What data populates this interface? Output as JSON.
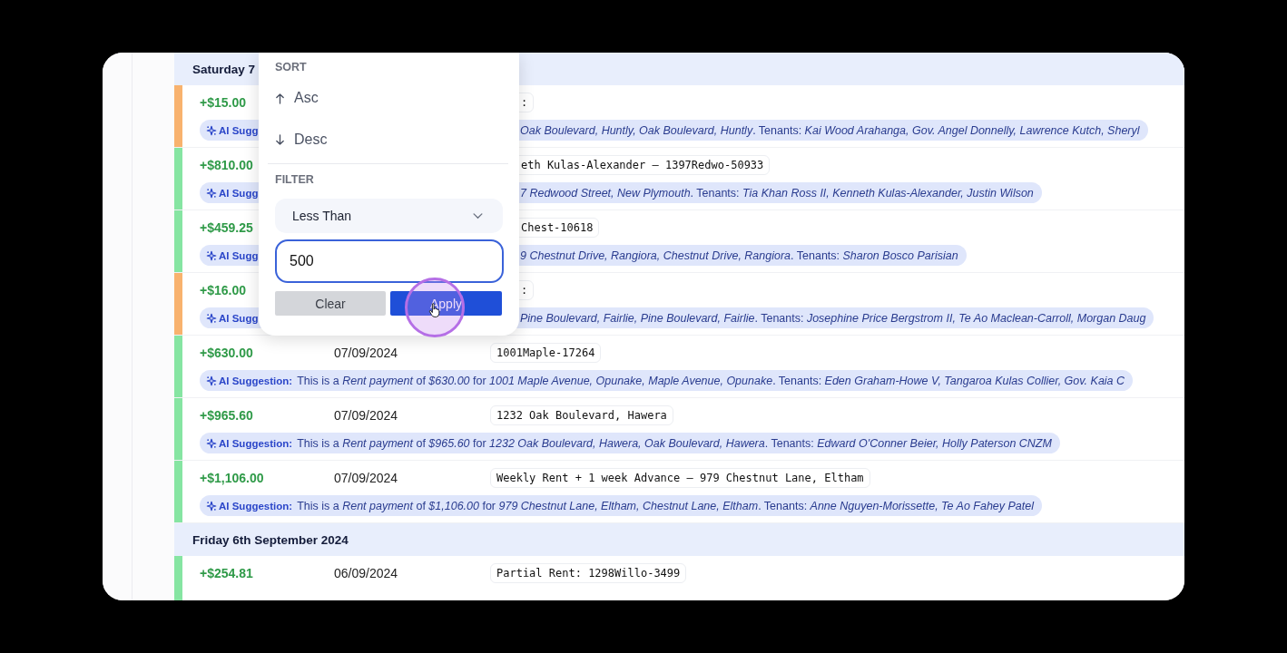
{
  "popup": {
    "sort_heading": "SORT",
    "sort_options": [
      {
        "kind": "asc",
        "label": "Asc"
      },
      {
        "kind": "desc",
        "label": "Desc"
      }
    ],
    "filter_heading": "FILTER",
    "condition": "Less Than",
    "value": "500",
    "buttons": [
      {
        "kind": "secondary",
        "label": "Clear"
      },
      {
        "kind": "primary",
        "label": "Apply"
      }
    ]
  },
  "groups": [
    {
      "heading": "Saturday 7",
      "transactions": [
        {
          "amount": "+$15.00",
          "color": "#f8b26e",
          "reference": ":",
          "suggestion_label": "AI Sugg",
          "suggestion": "*Oak Boulevard, Huntly, Oak Boulevard, Huntly*. Tenants: *Kai Wood Arahanga, Gov. Angel Donnelly, Lawrence Kutch, Sheryl*"
        },
        {
          "amount": "+$810.00",
          "color": "#86e5a2",
          "reference": "eth Kulas-Alexander – 1397Redwo-50933",
          "suggestion_label": "AI Sugg",
          "suggestion": "*7 Redwood Street, New Plymouth*. Tenants: *Tia Khan Ross II, Kenneth Kulas-Alexander, Justin Wilson*"
        },
        {
          "amount": "+$459.25",
          "color": "#86e5a2",
          "reference": "Chest-10618",
          "suggestion_label": "AI Sugg",
          "suggestion": "*9 Chestnut Drive, Rangiora, Chestnut Drive, Rangiora*. Tenants: *Sharon Bosco Parisian*"
        },
        {
          "amount": "+$16.00",
          "color": "#f8b26e",
          "reference": ":",
          "suggestion_label": "AI Sugg",
          "suggestion": "*Pine Boulevard, Fairlie, Pine Boulevard, Fairlie*. Tenants: *Josephine Price Bergstrom II, Te Ao Maclean-Carroll, Morgan Daug*"
        },
        {
          "amount": "+$630.00",
          "color": "#86e5a2",
          "date": "07/09/2024",
          "reference": "1001Maple-17264",
          "suggestion_label": "AI Suggestion:",
          "suggestion": "This is a *Rent payment* of *$630.00* for *1001 Maple Avenue, Opunake, Maple Avenue, Opunake*. Tenants: *Eden Graham-Howe V, Tangaroa Kulas Collier, Gov. Kaia C*"
        },
        {
          "amount": "+$965.60",
          "color": "#86e5a2",
          "date": "07/09/2024",
          "reference": "1232 Oak Boulevard, Hawera",
          "suggestion_label": "AI Suggestion:",
          "suggestion": "This is a *Rent payment* of *$965.60* for *1232 Oak Boulevard, Hawera, Oak Boulevard, Hawera*. Tenants: *Edward O'Conner Beier, Holly Paterson CNZM*"
        },
        {
          "amount": "+$1,106.00",
          "color": "#86e5a2",
          "date": "07/09/2024",
          "reference": "Weekly Rent + 1 week Advance – 979 Chestnut Lane, Eltham",
          "suggestion_label": "AI Suggestion:",
          "suggestion": "This is a *Rent payment* of *$1,106.00* for *979 Chestnut Lane, Eltham, Chestnut Lane, Eltham*. Tenants: *Anne Nguyen-Morissette, Te Ao Fahey Patel*"
        }
      ]
    },
    {
      "heading": "Friday 6th September 2024",
      "transactions": [
        {
          "amount": "+$254.81",
          "color": "#86e5a2",
          "date": "06/09/2024",
          "reference": "Partial Rent: 1298Willo-3499"
        }
      ]
    }
  ]
}
